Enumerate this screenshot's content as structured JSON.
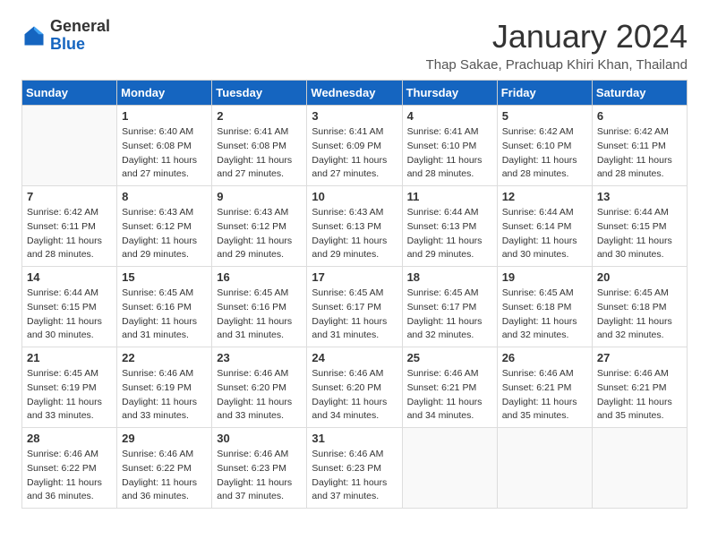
{
  "header": {
    "logo_general": "General",
    "logo_blue": "Blue",
    "month_title": "January 2024",
    "location": "Thap Sakae, Prachuap Khiri Khan, Thailand"
  },
  "days_of_week": [
    "Sunday",
    "Monday",
    "Tuesday",
    "Wednesday",
    "Thursday",
    "Friday",
    "Saturday"
  ],
  "weeks": [
    [
      {
        "day": "",
        "sunrise": "",
        "sunset": "",
        "daylight": ""
      },
      {
        "day": "1",
        "sunrise": "Sunrise: 6:40 AM",
        "sunset": "Sunset: 6:08 PM",
        "daylight": "Daylight: 11 hours and 27 minutes."
      },
      {
        "day": "2",
        "sunrise": "Sunrise: 6:41 AM",
        "sunset": "Sunset: 6:08 PM",
        "daylight": "Daylight: 11 hours and 27 minutes."
      },
      {
        "day": "3",
        "sunrise": "Sunrise: 6:41 AM",
        "sunset": "Sunset: 6:09 PM",
        "daylight": "Daylight: 11 hours and 27 minutes."
      },
      {
        "day": "4",
        "sunrise": "Sunrise: 6:41 AM",
        "sunset": "Sunset: 6:10 PM",
        "daylight": "Daylight: 11 hours and 28 minutes."
      },
      {
        "day": "5",
        "sunrise": "Sunrise: 6:42 AM",
        "sunset": "Sunset: 6:10 PM",
        "daylight": "Daylight: 11 hours and 28 minutes."
      },
      {
        "day": "6",
        "sunrise": "Sunrise: 6:42 AM",
        "sunset": "Sunset: 6:11 PM",
        "daylight": "Daylight: 11 hours and 28 minutes."
      }
    ],
    [
      {
        "day": "7",
        "sunrise": "Sunrise: 6:42 AM",
        "sunset": "Sunset: 6:11 PM",
        "daylight": "Daylight: 11 hours and 28 minutes."
      },
      {
        "day": "8",
        "sunrise": "Sunrise: 6:43 AM",
        "sunset": "Sunset: 6:12 PM",
        "daylight": "Daylight: 11 hours and 29 minutes."
      },
      {
        "day": "9",
        "sunrise": "Sunrise: 6:43 AM",
        "sunset": "Sunset: 6:12 PM",
        "daylight": "Daylight: 11 hours and 29 minutes."
      },
      {
        "day": "10",
        "sunrise": "Sunrise: 6:43 AM",
        "sunset": "Sunset: 6:13 PM",
        "daylight": "Daylight: 11 hours and 29 minutes."
      },
      {
        "day": "11",
        "sunrise": "Sunrise: 6:44 AM",
        "sunset": "Sunset: 6:13 PM",
        "daylight": "Daylight: 11 hours and 29 minutes."
      },
      {
        "day": "12",
        "sunrise": "Sunrise: 6:44 AM",
        "sunset": "Sunset: 6:14 PM",
        "daylight": "Daylight: 11 hours and 30 minutes."
      },
      {
        "day": "13",
        "sunrise": "Sunrise: 6:44 AM",
        "sunset": "Sunset: 6:15 PM",
        "daylight": "Daylight: 11 hours and 30 minutes."
      }
    ],
    [
      {
        "day": "14",
        "sunrise": "Sunrise: 6:44 AM",
        "sunset": "Sunset: 6:15 PM",
        "daylight": "Daylight: 11 hours and 30 minutes."
      },
      {
        "day": "15",
        "sunrise": "Sunrise: 6:45 AM",
        "sunset": "Sunset: 6:16 PM",
        "daylight": "Daylight: 11 hours and 31 minutes."
      },
      {
        "day": "16",
        "sunrise": "Sunrise: 6:45 AM",
        "sunset": "Sunset: 6:16 PM",
        "daylight": "Daylight: 11 hours and 31 minutes."
      },
      {
        "day": "17",
        "sunrise": "Sunrise: 6:45 AM",
        "sunset": "Sunset: 6:17 PM",
        "daylight": "Daylight: 11 hours and 31 minutes."
      },
      {
        "day": "18",
        "sunrise": "Sunrise: 6:45 AM",
        "sunset": "Sunset: 6:17 PM",
        "daylight": "Daylight: 11 hours and 32 minutes."
      },
      {
        "day": "19",
        "sunrise": "Sunrise: 6:45 AM",
        "sunset": "Sunset: 6:18 PM",
        "daylight": "Daylight: 11 hours and 32 minutes."
      },
      {
        "day": "20",
        "sunrise": "Sunrise: 6:45 AM",
        "sunset": "Sunset: 6:18 PM",
        "daylight": "Daylight: 11 hours and 32 minutes."
      }
    ],
    [
      {
        "day": "21",
        "sunrise": "Sunrise: 6:45 AM",
        "sunset": "Sunset: 6:19 PM",
        "daylight": "Daylight: 11 hours and 33 minutes."
      },
      {
        "day": "22",
        "sunrise": "Sunrise: 6:46 AM",
        "sunset": "Sunset: 6:19 PM",
        "daylight": "Daylight: 11 hours and 33 minutes."
      },
      {
        "day": "23",
        "sunrise": "Sunrise: 6:46 AM",
        "sunset": "Sunset: 6:20 PM",
        "daylight": "Daylight: 11 hours and 33 minutes."
      },
      {
        "day": "24",
        "sunrise": "Sunrise: 6:46 AM",
        "sunset": "Sunset: 6:20 PM",
        "daylight": "Daylight: 11 hours and 34 minutes."
      },
      {
        "day": "25",
        "sunrise": "Sunrise: 6:46 AM",
        "sunset": "Sunset: 6:21 PM",
        "daylight": "Daylight: 11 hours and 34 minutes."
      },
      {
        "day": "26",
        "sunrise": "Sunrise: 6:46 AM",
        "sunset": "Sunset: 6:21 PM",
        "daylight": "Daylight: 11 hours and 35 minutes."
      },
      {
        "day": "27",
        "sunrise": "Sunrise: 6:46 AM",
        "sunset": "Sunset: 6:21 PM",
        "daylight": "Daylight: 11 hours and 35 minutes."
      }
    ],
    [
      {
        "day": "28",
        "sunrise": "Sunrise: 6:46 AM",
        "sunset": "Sunset: 6:22 PM",
        "daylight": "Daylight: 11 hours and 36 minutes."
      },
      {
        "day": "29",
        "sunrise": "Sunrise: 6:46 AM",
        "sunset": "Sunset: 6:22 PM",
        "daylight": "Daylight: 11 hours and 36 minutes."
      },
      {
        "day": "30",
        "sunrise": "Sunrise: 6:46 AM",
        "sunset": "Sunset: 6:23 PM",
        "daylight": "Daylight: 11 hours and 37 minutes."
      },
      {
        "day": "31",
        "sunrise": "Sunrise: 6:46 AM",
        "sunset": "Sunset: 6:23 PM",
        "daylight": "Daylight: 11 hours and 37 minutes."
      },
      {
        "day": "",
        "sunrise": "",
        "sunset": "",
        "daylight": ""
      },
      {
        "day": "",
        "sunrise": "",
        "sunset": "",
        "daylight": ""
      },
      {
        "day": "",
        "sunrise": "",
        "sunset": "",
        "daylight": ""
      }
    ]
  ]
}
